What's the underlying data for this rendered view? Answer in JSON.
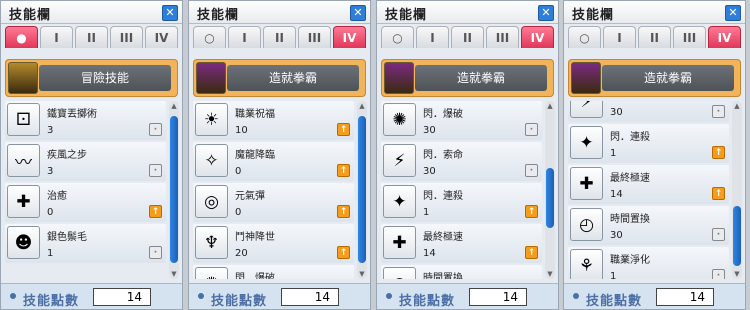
{
  "panels": [
    {
      "title": "技能欄",
      "tabs": [
        "●",
        "I",
        "II",
        "III",
        "IV"
      ],
      "active_tab": 0,
      "category_icon_color": "#b38a2a",
      "category": "冒險技能",
      "skills": [
        {
          "icon": "dice-icon",
          "glyph": "⚀",
          "name": "鐵寶丟擲術",
          "level": "3",
          "plus": false
        },
        {
          "icon": "feather-icon",
          "glyph": "〰",
          "name": "疾風之步",
          "level": "3",
          "plus": false
        },
        {
          "icon": "heal-cross-icon",
          "glyph": "✚",
          "name": "治癒",
          "level": "0",
          "plus": true
        },
        {
          "icon": "silver-mane-icon",
          "glyph": "☻",
          "name": "銀色鬃毛",
          "level": "1",
          "plus": false
        }
      ],
      "scroll": {
        "thumb_top_pct": 0.03,
        "thumb_size_pct": 0.93
      },
      "footer_label": "技能點數",
      "skill_points": "14"
    },
    {
      "title": "技能欄",
      "tabs": [
        "○",
        "I",
        "II",
        "III",
        "IV"
      ],
      "active_tab": 4,
      "category_icon_color": "#7a2b7f",
      "category": "造就拳霸",
      "skills": [
        {
          "icon": "class-blessing-icon",
          "glyph": "☀",
          "name": "職業祝福",
          "level": "10",
          "plus": true
        },
        {
          "icon": "dragon-descent-icon",
          "glyph": "✧",
          "name": "魔龍降臨",
          "level": "0",
          "plus": true
        },
        {
          "icon": "energy-orb-icon",
          "glyph": "◎",
          "name": "元氣彈",
          "level": "0",
          "plus": true
        },
        {
          "icon": "war-god-icon",
          "glyph": "♆",
          "name": "鬥神降世",
          "level": "20",
          "plus": true
        },
        {
          "icon": "flash-burst-icon",
          "glyph": "✺",
          "name": "閃．爆破",
          "level": "",
          "plus": false
        }
      ],
      "scroll": {
        "thumb_top_pct": 0.03,
        "thumb_size_pct": 0.93
      },
      "footer_label": "技能點數",
      "skill_points": "14"
    },
    {
      "title": "技能欄",
      "tabs": [
        "○",
        "I",
        "II",
        "III",
        "IV"
      ],
      "active_tab": 4,
      "category_icon_color": "#7a2b7f",
      "category": "造就拳霸",
      "skills": [
        {
          "icon": "flash-burst-icon",
          "glyph": "✺",
          "name": "閃．爆破",
          "level": "30",
          "plus": false
        },
        {
          "icon": "flash-chain-icon",
          "glyph": "⚡",
          "name": "閃．索命",
          "level": "30",
          "plus": false
        },
        {
          "icon": "flash-combo-icon",
          "glyph": "✦",
          "name": "閃．連殺",
          "level": "1",
          "plus": true
        },
        {
          "icon": "max-speed-icon",
          "glyph": "✚",
          "name": "最終極速",
          "level": "14",
          "plus": true
        },
        {
          "icon": "time-swap-icon",
          "glyph": "◴",
          "name": "時間置換",
          "level": "",
          "plus": false
        }
      ],
      "scroll": {
        "thumb_top_pct": 0.36,
        "thumb_size_pct": 0.38
      },
      "footer_label": "技能點數",
      "skill_points": "14"
    },
    {
      "title": "技能欄",
      "tabs": [
        "○",
        "I",
        "II",
        "III",
        "IV"
      ],
      "active_tab": 4,
      "category_icon_color": "#7a2b7f",
      "category": "造就拳霸",
      "skills": [
        {
          "icon": "flash-chain-icon",
          "glyph": "⚡",
          "name": "",
          "level": "30",
          "plus": false
        },
        {
          "icon": "flash-combo-icon",
          "glyph": "✦",
          "name": "閃．連殺",
          "level": "1",
          "plus": true
        },
        {
          "icon": "max-speed-icon",
          "glyph": "✚",
          "name": "最終極速",
          "level": "14",
          "plus": true
        },
        {
          "icon": "time-swap-icon",
          "glyph": "◴",
          "name": "時間置換",
          "level": "30",
          "plus": false
        },
        {
          "icon": "class-purify-icon",
          "glyph": "⚘",
          "name": "職業淨化",
          "level": "1",
          "plus": false
        }
      ],
      "scroll": {
        "thumb_top_pct": 0.6,
        "thumb_size_pct": 0.38
      },
      "footer_label": "技能點數",
      "skill_points": "14"
    }
  ]
}
